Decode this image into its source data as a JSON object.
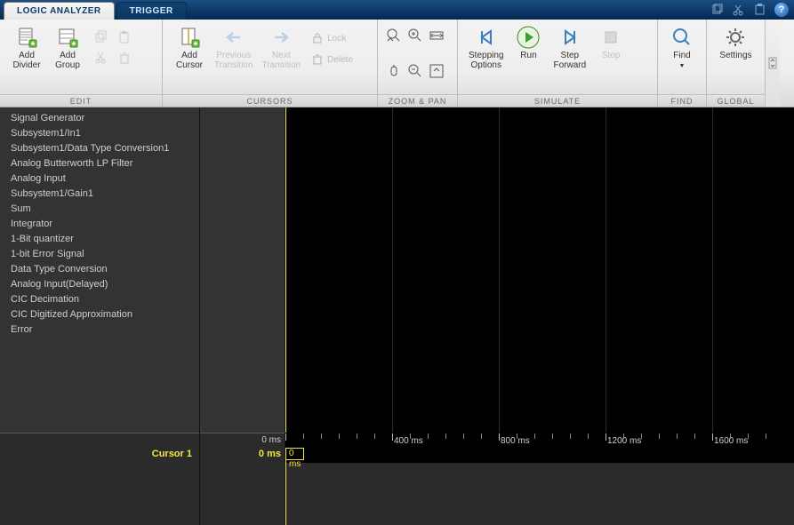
{
  "tabs": {
    "logic_analyzer": "LOGIC ANALYZER",
    "trigger": "TRIGGER"
  },
  "ribbon": {
    "edit": {
      "label": "EDIT",
      "add_divider": "Add\nDivider",
      "add_group": "Add\nGroup"
    },
    "cursors": {
      "label": "CURSORS",
      "add_cursor": "Add\nCursor",
      "prev_transition": "Previous\nTransition",
      "next_transition": "Next\nTransition",
      "lock": "Lock",
      "delete": "Delete"
    },
    "zoom_pan": {
      "label": "ZOOM & PAN"
    },
    "simulate": {
      "label": "SIMULATE",
      "stepping_options": "Stepping\nOptions",
      "run": "Run",
      "step_forward": "Step\nForward",
      "stop": "Stop"
    },
    "find": {
      "label": "FIND",
      "find": "Find"
    },
    "global": {
      "label": "GLOBAL",
      "settings": "Settings"
    }
  },
  "signals": [
    "Signal Generator",
    "Subsystem1/In1",
    "Subsystem1/Data Type Conversion1",
    "Analog Butterworth LP Filter",
    "Analog Input",
    "Subsystem1/Gain1",
    "Sum",
    "Integrator",
    "1-Bit quantizer",
    "1-bit Error Signal",
    "Data Type Conversion",
    "Analog Input(Delayed)",
    "CIC Decimation",
    "CIC Digitized Approximation",
    "Error"
  ],
  "timeline": {
    "ticks": [
      "0 ms",
      "400 ms",
      "800 ms",
      "1200 ms",
      "1600 ms"
    ]
  },
  "cursor": {
    "name": "Cursor 1",
    "value_left": "0 ms",
    "value_flag": "0 ms"
  }
}
